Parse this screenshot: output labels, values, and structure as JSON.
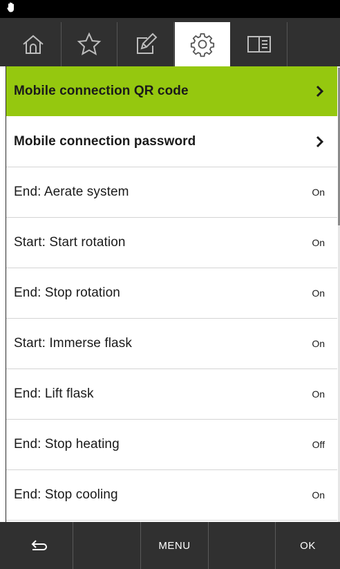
{
  "tabs": [
    {
      "name": "home",
      "icon": "home-icon",
      "active": false
    },
    {
      "name": "favorites",
      "icon": "star-icon",
      "active": false
    },
    {
      "name": "edit",
      "icon": "edit-icon",
      "active": false
    },
    {
      "name": "settings",
      "icon": "gear-icon",
      "active": true
    },
    {
      "name": "manual",
      "icon": "book-icon",
      "active": false
    }
  ],
  "rows": [
    {
      "label": "Mobile connection QR code",
      "type": "nav",
      "highlighted": true
    },
    {
      "label": "Mobile connection password",
      "type": "nav",
      "highlighted": false
    },
    {
      "label": "End: Aerate system",
      "value": "On"
    },
    {
      "label": "Start: Start rotation",
      "value": "On"
    },
    {
      "label": "End: Stop rotation",
      "value": "On"
    },
    {
      "label": "Start: Immerse flask",
      "value": "On"
    },
    {
      "label": "End: Lift flask",
      "value": "On"
    },
    {
      "label": "End: Stop heating",
      "value": "Off"
    },
    {
      "label": "End: Stop cooling",
      "value": "On"
    }
  ],
  "bottom": {
    "back_icon": "return-arrow-icon",
    "menu_label": "MENU",
    "ok_label": "OK"
  },
  "colors": {
    "highlight": "#95c80f",
    "bar": "#303030"
  }
}
